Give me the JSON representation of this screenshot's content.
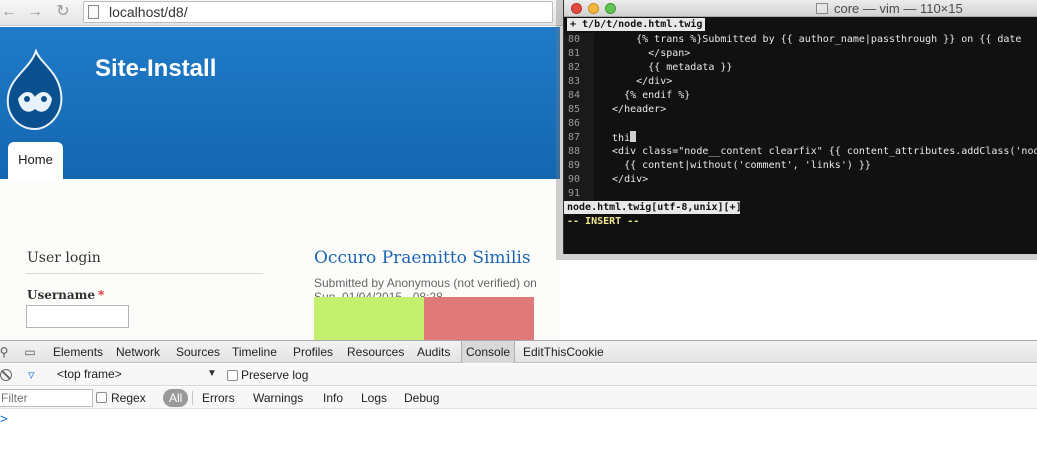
{
  "browser": {
    "url": "localhost/d8/",
    "back_glyph": "←",
    "forward_glyph": "→",
    "reload_glyph": "↻"
  },
  "site": {
    "name": "Site-Install",
    "tabs": [
      "Home"
    ],
    "header_color": "#1a6fbd"
  },
  "sidebar": {
    "block_title": "User login",
    "username_label": "Username",
    "required_mark": "*",
    "username_value": ""
  },
  "node": {
    "title": "Occuro Praemitto Similis",
    "submitted": "Submitted by Anonymous (not verified) on Sun, 01/04/2015 - 08:28"
  },
  "terminal": {
    "title": "core — vim — 110×15",
    "tabline": "+ t/b/t/node.html.twig",
    "lines": [
      {
        "n": "80",
        "text": "      {% trans %}Submitted by {{ author_name|passthrough }} on {{ date"
      },
      {
        "n": "81",
        "text": "        </span>"
      },
      {
        "n": "82",
        "text": "        {{ metadata }}"
      },
      {
        "n": "83",
        "text": "      </div>"
      },
      {
        "n": "84",
        "text": "    {% endif %}"
      },
      {
        "n": "85",
        "text": "  </header>"
      },
      {
        "n": "86",
        "text": ""
      },
      {
        "n": "87",
        "text": "  thi"
      },
      {
        "n": "88",
        "text": "  <div class=\"node__content clearfix\" {{ content_attributes.addClass('node_"
      },
      {
        "n": "89",
        "text": "    {{ content|without('comment', 'links') }}"
      },
      {
        "n": "90",
        "text": "  </div>"
      },
      {
        "n": "91",
        "text": ""
      }
    ],
    "statusline": "node.html.twig[utf-8,unix][+]",
    "mode": "-- INSERT --"
  },
  "devtools": {
    "tabs": [
      "Elements",
      "Network",
      "Sources",
      "Timeline",
      "Profiles",
      "Resources",
      "Audits",
      "Console",
      "EditThisCookie"
    ],
    "active_tab": "Console",
    "frame": "<top frame>",
    "preserve_log": "Preserve log",
    "filter_placeholder": "Filter",
    "regex": "Regex",
    "levels": [
      "All",
      "Errors",
      "Warnings",
      "Info",
      "Logs",
      "Debug"
    ],
    "prompt": ">"
  }
}
